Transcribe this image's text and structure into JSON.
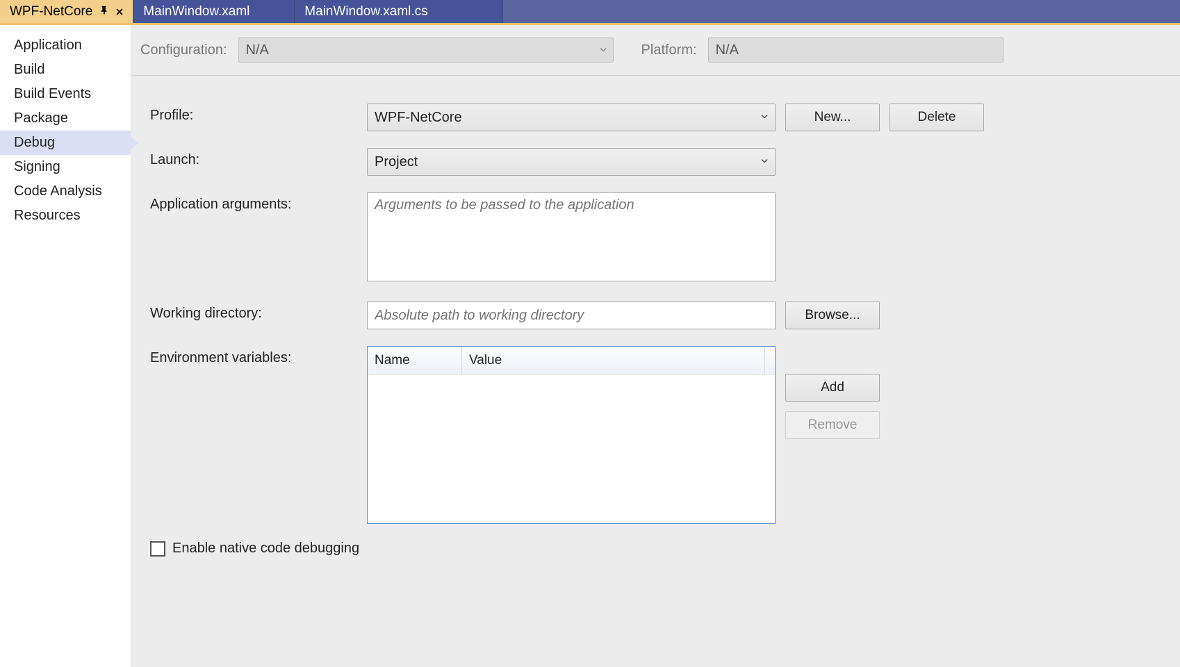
{
  "tabs": [
    {
      "label": "WPF-NetCore",
      "active": true,
      "pinned": true,
      "closable": true
    },
    {
      "label": "MainWindow.xaml",
      "active": false
    },
    {
      "label": "MainWindow.xaml.cs",
      "active": false
    }
  ],
  "sidebar": {
    "items": [
      {
        "label": "Application"
      },
      {
        "label": "Build"
      },
      {
        "label": "Build Events"
      },
      {
        "label": "Package"
      },
      {
        "label": "Debug",
        "selected": true
      },
      {
        "label": "Signing"
      },
      {
        "label": "Code Analysis"
      },
      {
        "label": "Resources"
      }
    ]
  },
  "configBar": {
    "configuration_label": "Configuration:",
    "configuration_value": "N/A",
    "platform_label": "Platform:",
    "platform_value": "N/A"
  },
  "form": {
    "profile_label": "Profile:",
    "profile_value": "WPF-NetCore",
    "new_button": "New...",
    "delete_button": "Delete",
    "launch_label": "Launch:",
    "launch_value": "Project",
    "args_label": "Application arguments:",
    "args_placeholder": "Arguments to be passed to the application",
    "workdir_label": "Working directory:",
    "workdir_placeholder": "Absolute path to working directory",
    "browse_button": "Browse...",
    "envvars_label": "Environment variables:",
    "env_name_header": "Name",
    "env_value_header": "Value",
    "add_button": "Add",
    "remove_button": "Remove",
    "native_debug_label": "Enable native code debugging",
    "native_debug_checked": false
  }
}
